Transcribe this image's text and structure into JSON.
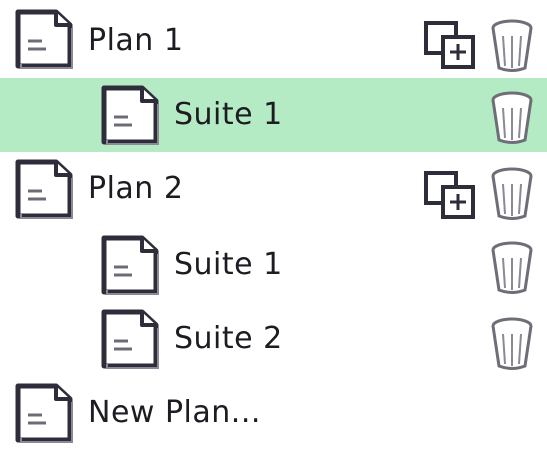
{
  "tree": {
    "items": [
      {
        "label": "Plan 1",
        "kind": "plan",
        "icon": "document-icon",
        "actions": [
          "copy-add-icon",
          "trash-icon"
        ]
      },
      {
        "label": "Suite 1",
        "kind": "suite",
        "selected": true,
        "icon": "document-icon",
        "actions": [
          "trash-icon"
        ]
      },
      {
        "label": "Plan 2",
        "kind": "plan",
        "icon": "document-icon",
        "actions": [
          "copy-add-icon",
          "trash-icon"
        ]
      },
      {
        "label": "Suite 1",
        "kind": "suite",
        "icon": "document-icon",
        "actions": [
          "trash-icon"
        ]
      },
      {
        "label": "Suite 2",
        "kind": "suite",
        "icon": "document-icon",
        "actions": [
          "trash-icon"
        ]
      },
      {
        "label": "New Plan...",
        "kind": "new-plan",
        "icon": "document-icon",
        "actions": []
      }
    ]
  },
  "colors": {
    "selection": "#b5ebc4",
    "ink": "#1c1c22",
    "icon_outline": "#3a3a46"
  }
}
